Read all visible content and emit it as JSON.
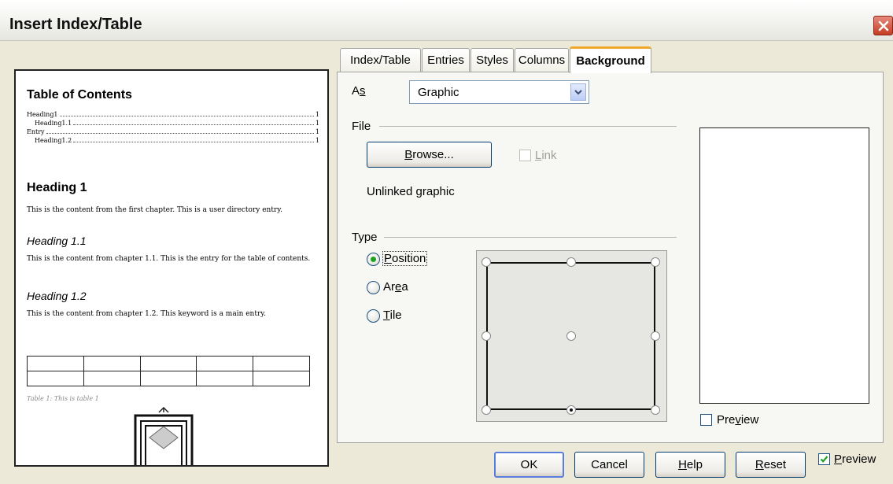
{
  "window": {
    "title": "Insert Index/Table"
  },
  "icons": {
    "close": "close-icon",
    "dropdown": "chevron-down-icon",
    "check": "checkmark-icon"
  },
  "colors": {
    "tab_accent": "#f0a82a",
    "radio_selected": "#21a121",
    "close_button": "#c63c24"
  },
  "preview_page": {
    "toc_title": "Table of Contents",
    "toc_entries": [
      {
        "text": "Heading1",
        "page": "1"
      },
      {
        "text": "Heading1.1",
        "page": "1"
      },
      {
        "text": "Entry",
        "page": "1"
      },
      {
        "text": "Heading1.2",
        "page": "1"
      }
    ],
    "heading1": "Heading 1",
    "heading1_body": "This is the content from the first chapter. This is a user directory entry.",
    "heading11": "Heading 1.1",
    "heading11_body": "This is the content from chapter 1.1. This is the entry for the table of contents.",
    "heading12": "Heading 1.2",
    "heading12_body": "This is the content from chapter 1.2. This keyword is a main entry.",
    "table_caption": "Table 1: This is table 1"
  },
  "tabs": [
    {
      "label": "Index/Table",
      "active": false
    },
    {
      "label": "Entries",
      "active": false
    },
    {
      "label": "Styles",
      "active": false
    },
    {
      "label": "Columns",
      "active": false
    },
    {
      "label": "Background",
      "active": true
    }
  ],
  "background": {
    "as_label_prefix": "A",
    "as_label_mnemonic": "s",
    "as_value": "Graphic",
    "file_section": "File",
    "browse_pre": "",
    "browse_mnemonic": "B",
    "browse_post": "rowse...",
    "link_mnemonic": "L",
    "link_post": "ink",
    "link_checked": false,
    "status": "Unlinked graphic",
    "type_section": "Type",
    "types": [
      {
        "pre": "",
        "mnemonic": "P",
        "post": "osition",
        "selected": true
      },
      {
        "pre": "Ar",
        "mnemonic": "e",
        "post": "a",
        "selected": false
      },
      {
        "pre": "",
        "mnemonic": "T",
        "post": "ile",
        "selected": false
      }
    ],
    "position_selected": "bottom-center",
    "preview_pre": "Pre",
    "preview_mnemonic": "v",
    "preview_post": "iew",
    "preview_checked": false
  },
  "footer": {
    "ok": "OK",
    "cancel": "Cancel",
    "help_mnemonic": "H",
    "help_post": "elp",
    "reset_mnemonic": "R",
    "reset_post": "eset",
    "preview_mnemonic": "P",
    "preview_post": "review",
    "preview_checked": true
  }
}
